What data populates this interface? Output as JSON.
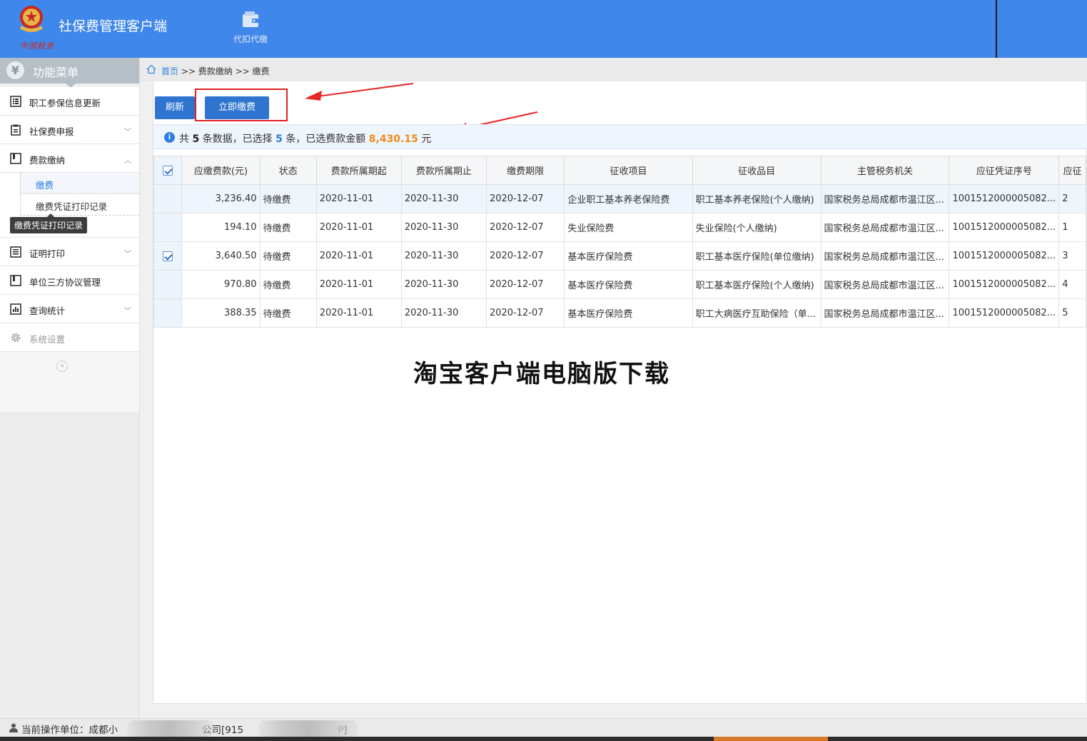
{
  "header": {
    "app_title": "社保费管理客户端",
    "emblem_subtext": "中国税务",
    "tools": [
      {
        "label": "代扣代缴",
        "icon": "wallet-icon"
      }
    ]
  },
  "sidebar": {
    "menu_title": "功能菜单",
    "items": [
      {
        "label": "职工参保信息更新",
        "icon": "list-icon",
        "chevron": ""
      },
      {
        "label": "社保费申报",
        "icon": "clipboard-icon",
        "chevron": "﹀"
      },
      {
        "label": "费款缴纳",
        "icon": "book-icon",
        "chevron": "︿"
      },
      {
        "label": "证明打印",
        "icon": "print-list-icon",
        "chevron": "﹀"
      },
      {
        "label": "单位三方协议管理",
        "icon": "book-icon",
        "chevron": ""
      },
      {
        "label": "查询统计",
        "icon": "chart-icon",
        "chevron": "﹀"
      },
      {
        "label": "系统设置",
        "icon": "gear-icon",
        "chevron": ""
      }
    ],
    "subitems": [
      {
        "label": "缴费"
      },
      {
        "label": "缴费凭证打印记录"
      }
    ],
    "tooltip": "缴费凭证打印记录",
    "collapse_glyph": "«"
  },
  "breadcrumb": {
    "home": "首页",
    "sep": ">>",
    "level2": "费款缴纳",
    "current": "缴费"
  },
  "toolbar": {
    "refresh_label": "刷新",
    "pay_label": "立即缴费"
  },
  "info": {
    "prefix": "共",
    "total": "5",
    "mid1": "条数据，已选择",
    "selected": "5",
    "mid2": "条，已选费款金额",
    "amount": "8,430.15",
    "unit": "元"
  },
  "table": {
    "columns": [
      "应缴费款(元)",
      "状态",
      "费款所属期起",
      "费款所属期止",
      "缴费期限",
      "征收项目",
      "征收品目",
      "主管税务机关",
      "应征凭证序号",
      "应征"
    ],
    "rows": [
      {
        "checked": false,
        "cells": [
          "3,236.40",
          "待缴费",
          "2020-11-01",
          "2020-11-30",
          "2020-12-07",
          "企业职工基本养老保险费",
          "职工基本养老保险(个人缴纳)",
          "国家税务总局成都市温江区...",
          "1001512000005082...",
          "2"
        ]
      },
      {
        "checked": false,
        "cells": [
          "194.10",
          "待缴费",
          "2020-11-01",
          "2020-11-30",
          "2020-12-07",
          "失业保险费",
          "失业保险(个人缴纳)",
          "国家税务总局成都市温江区...",
          "1001512000005082...",
          "1"
        ]
      },
      {
        "checked": true,
        "cells": [
          "3,640.50",
          "待缴费",
          "2020-11-01",
          "2020-11-30",
          "2020-12-07",
          "基本医疗保险费",
          "职工基本医疗保险(单位缴纳)",
          "国家税务总局成都市温江区...",
          "1001512000005082...",
          "3"
        ]
      },
      {
        "checked": false,
        "cells": [
          "970.80",
          "待缴费",
          "2020-11-01",
          "2020-11-30",
          "2020-12-07",
          "基本医疗保险费",
          "职工基本医疗保险(个人缴纳)",
          "国家税务总局成都市温江区...",
          "1001512000005082...",
          "4"
        ]
      },
      {
        "checked": false,
        "cells": [
          "388.35",
          "待缴费",
          "2020-11-01",
          "2020-11-30",
          "2020-12-07",
          "基本医疗保险费",
          "职工大病医疗互助保险（单...",
          "国家税务总局成都市温江区...",
          "1001512000005082...",
          "5"
        ]
      }
    ]
  },
  "watermark": "淘宝客户端电脑版下载",
  "footer": {
    "label": "当前操作单位：",
    "org_start": "成都小",
    "org_end": "公司[915",
    "code_end": "P]"
  },
  "colors": {
    "header_bg": "#3f87ea",
    "button_bg": "#2f75d0",
    "amount": "#f08a1c",
    "highlight": "#e02020"
  }
}
